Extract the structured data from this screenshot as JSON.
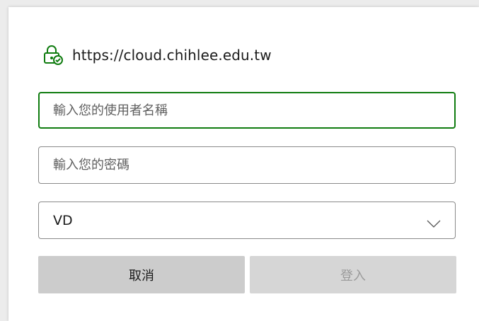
{
  "dialog": {
    "origin_url": "https://cloud.chihlee.edu.tw",
    "username_placeholder": "輸入您的使用者名稱",
    "username_value": "",
    "password_placeholder": "輸入您的密碼",
    "password_value": "",
    "domain_select": {
      "selected": "VD"
    },
    "cancel_label": "取消",
    "login_label": "登入"
  },
  "icons": {
    "origin_icon": "lock-check-icon",
    "select_icon": "chevron-down-icon"
  },
  "colors": {
    "focus_border": "#107c10",
    "cancel_bg": "#cccccc",
    "login_disabled_bg": "#d6d6d6",
    "login_disabled_text": "#9a9a9a"
  }
}
